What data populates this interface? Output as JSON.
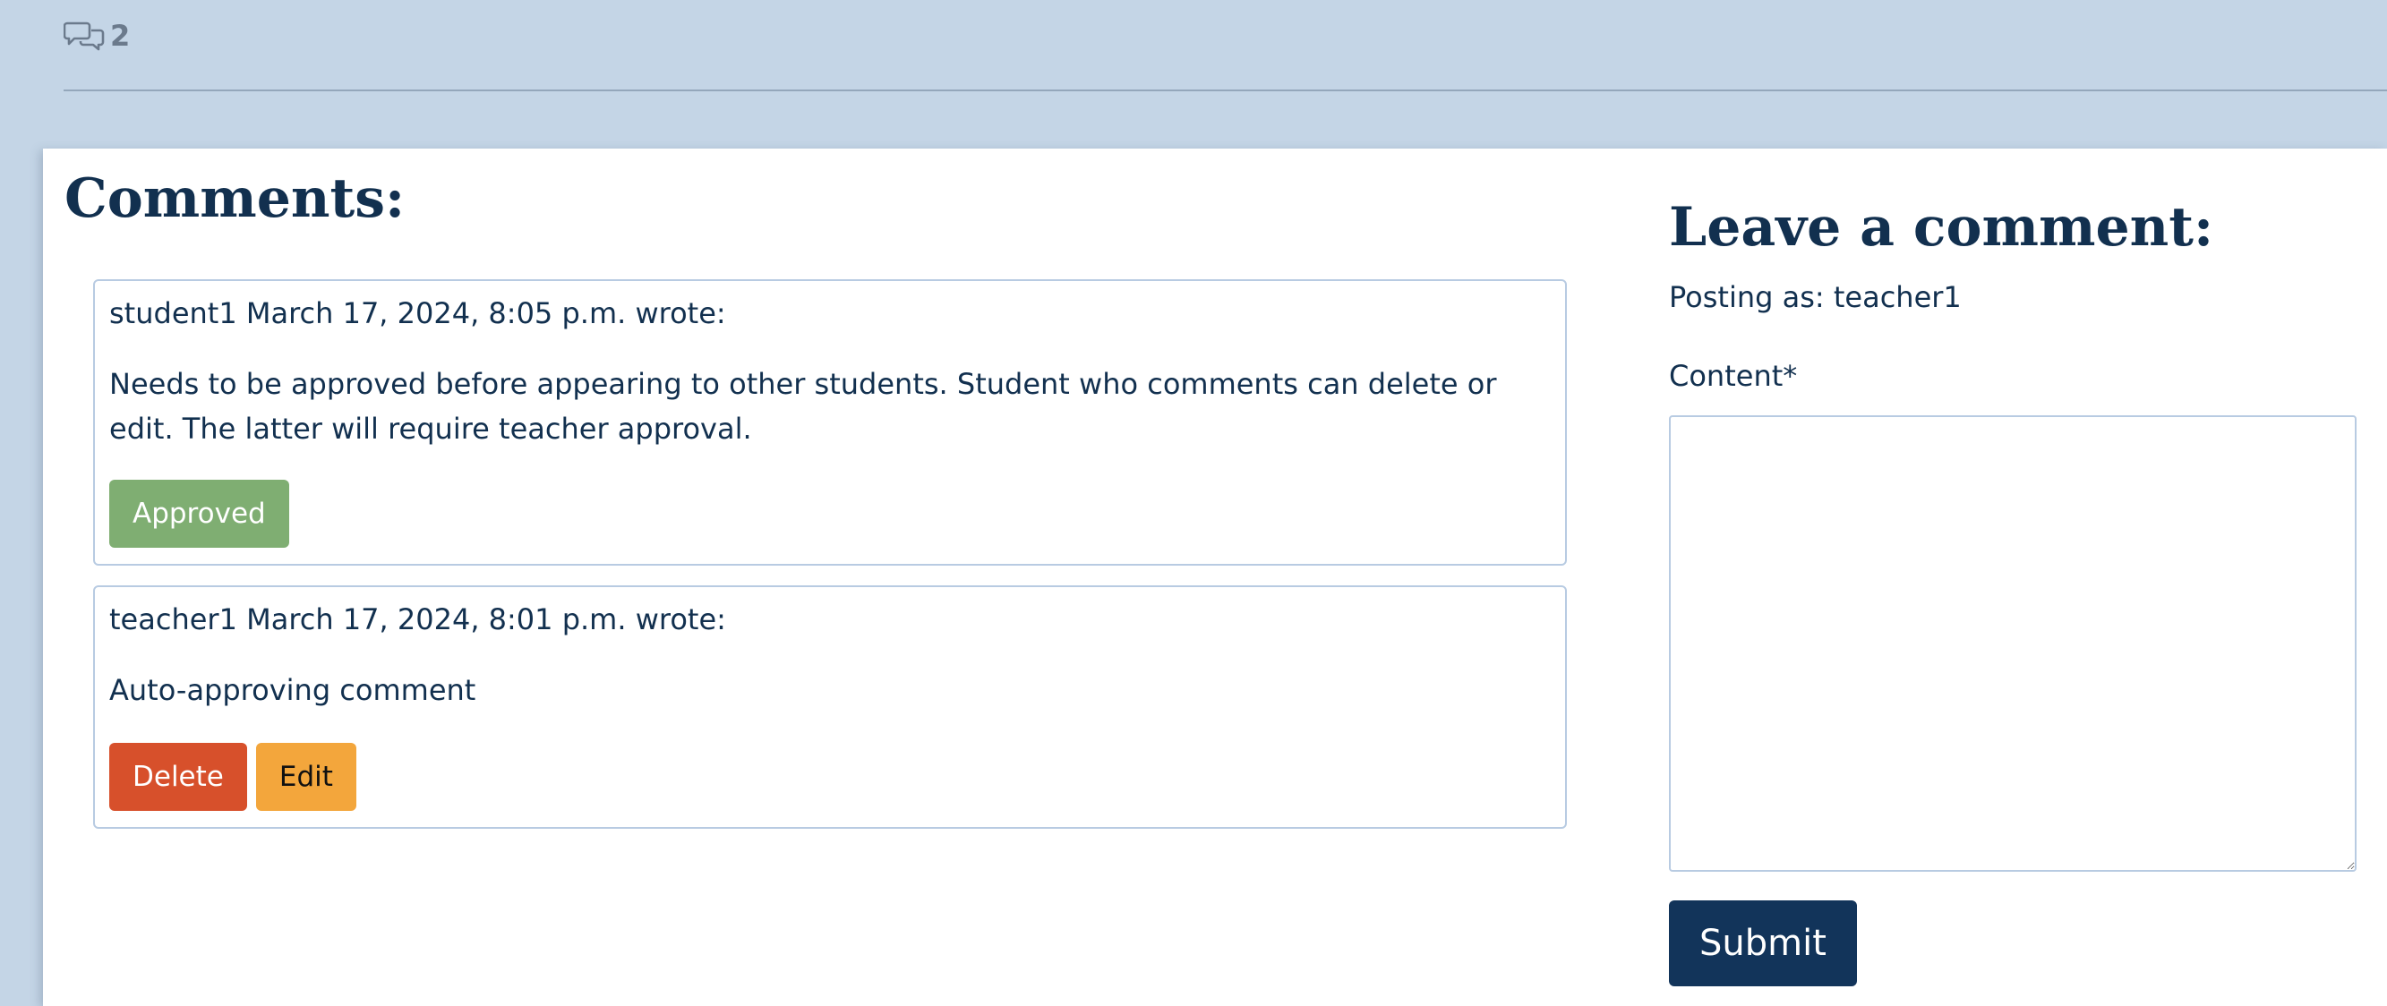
{
  "post_meta": {
    "comment_icon": "comments-icon",
    "comment_count": "2"
  },
  "comments_section": {
    "heading": "Comments:",
    "comments": [
      {
        "author": "student1",
        "timestamp": "March 17, 2024, 8:05 p.m.",
        "wrote_suffix": "wrote:",
        "header": "student1 March 17, 2024, 8:05 p.m. wrote:",
        "body": "Needs to be approved before appearing to other students. Student who comments can delete or edit. The latter will require teacher approval.",
        "status_label": "Approved"
      },
      {
        "author": "teacher1",
        "timestamp": "March 17, 2024, 8:01 p.m.",
        "wrote_suffix": "wrote:",
        "header": "teacher1 March 17, 2024, 8:01 p.m. wrote:",
        "body": "Auto-approving comment",
        "delete_label": "Delete",
        "edit_label": "Edit"
      }
    ]
  },
  "comment_form": {
    "heading": "Leave a comment:",
    "posting_as": "Posting as: teacher1",
    "content_label": "Content*",
    "content_value": "",
    "submit_label": "Submit"
  },
  "colors": {
    "page_background": "#c4d5e6",
    "card_background": "#ffffff",
    "text_primary": "#12304f",
    "approved": "#7fae72",
    "delete": "#d7502b",
    "edit": "#f3a63c",
    "submit": "#12345a",
    "comment_border": "#b8cbe2"
  }
}
